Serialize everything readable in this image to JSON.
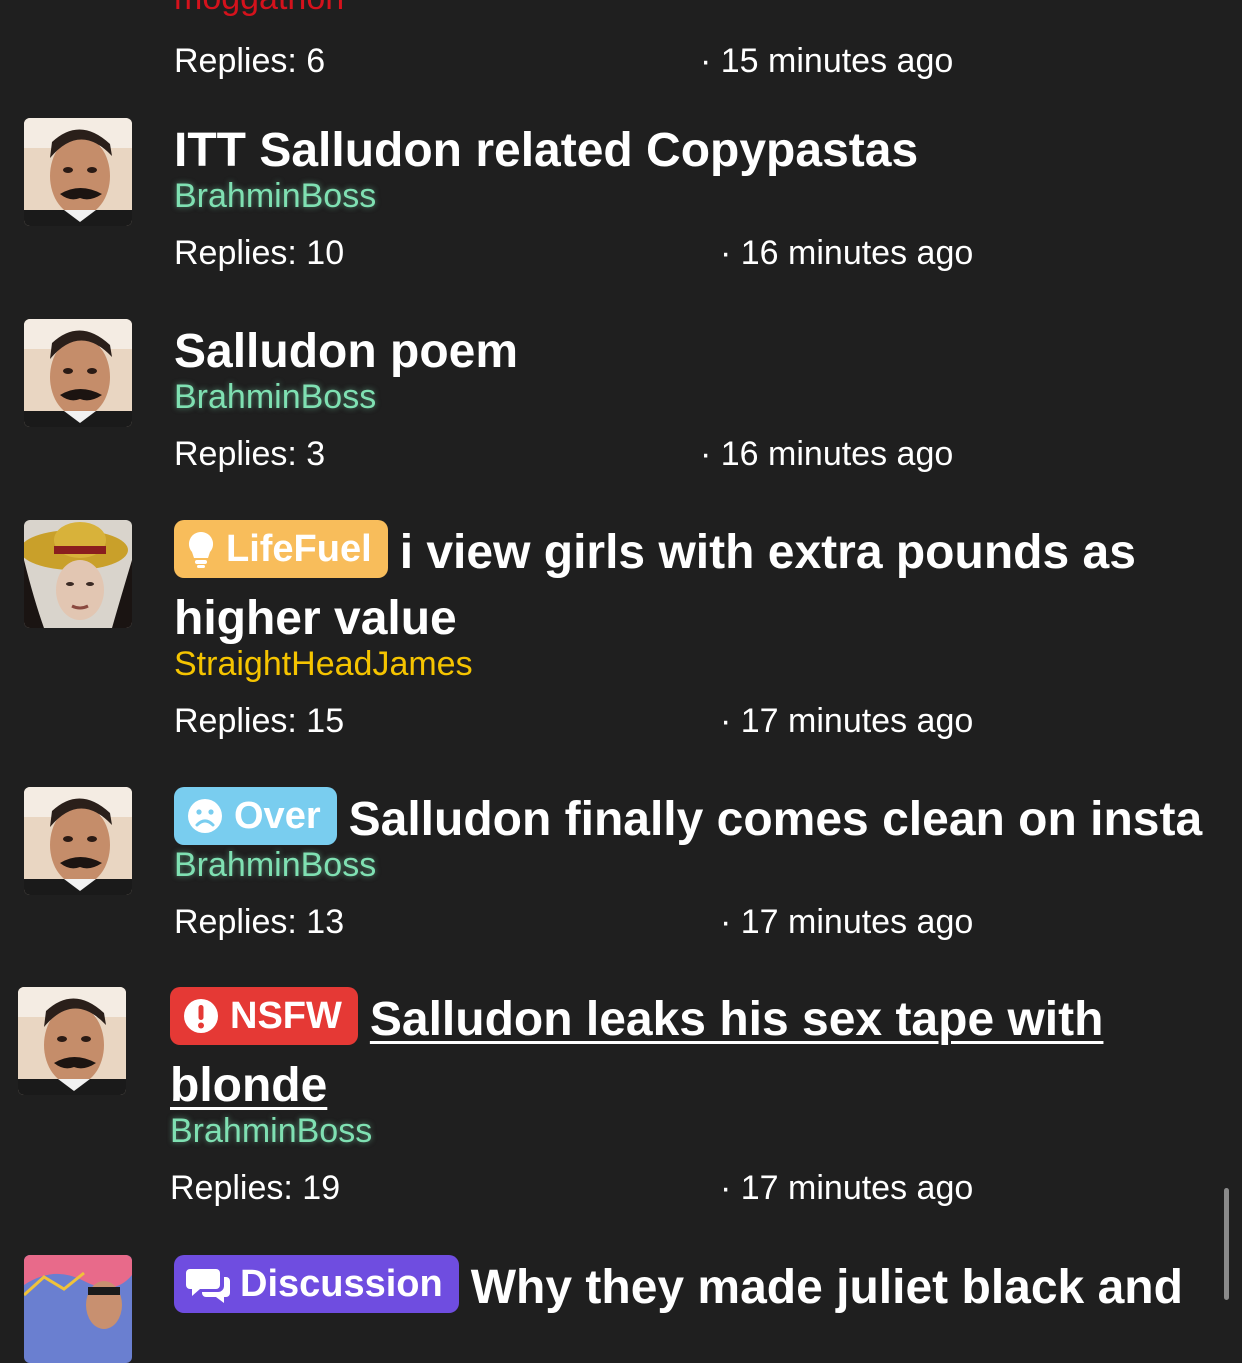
{
  "threads": [
    {
      "title": "",
      "author": "moggathon",
      "replies": "Replies: 6",
      "time": "· 15 minutes ago"
    },
    {
      "title": "ITT Salludon related Copypastas",
      "author": "BrahminBoss",
      "replies": "Replies: 10",
      "time": "· 16 minutes ago"
    },
    {
      "title": "Salludon poem",
      "author": "BrahminBoss",
      "replies": "Replies: 3",
      "time": "· 16 minutes ago"
    },
    {
      "badge": "LifeFuel",
      "title": "i view girls with extra pounds as higher value",
      "author": "StraightHeadJames",
      "replies": "Replies: 15",
      "time": "· 17 minutes ago"
    },
    {
      "badge": "Over",
      "title": "Salludon finally comes clean on insta",
      "author": "BrahminBoss",
      "replies": "Replies: 13",
      "time": "· 17 minutes ago"
    },
    {
      "badge": "NSFW",
      "title": "Salludon leaks his sex tape with blonde",
      "author": "BrahminBoss",
      "replies": "Replies: 19",
      "time": "· 17 minutes ago"
    },
    {
      "badge": "Discussion",
      "title": "Why they made juliet black and"
    }
  ],
  "colors": {
    "background": "#1f1f1f",
    "author_green": "#7fe0b2",
    "author_gold": "#f5c400",
    "author_red": "#d4121c",
    "badge_lifefuel": "#f8bd5b",
    "badge_over": "#79cdef",
    "badge_nsfw": "#e53935",
    "badge_discussion": "#6f4de0"
  },
  "icons": {
    "lifefuel": "lightbulb-icon",
    "over": "sad-face-icon",
    "nsfw": "exclamation-icon",
    "discussion": "chat-bubbles-icon"
  }
}
